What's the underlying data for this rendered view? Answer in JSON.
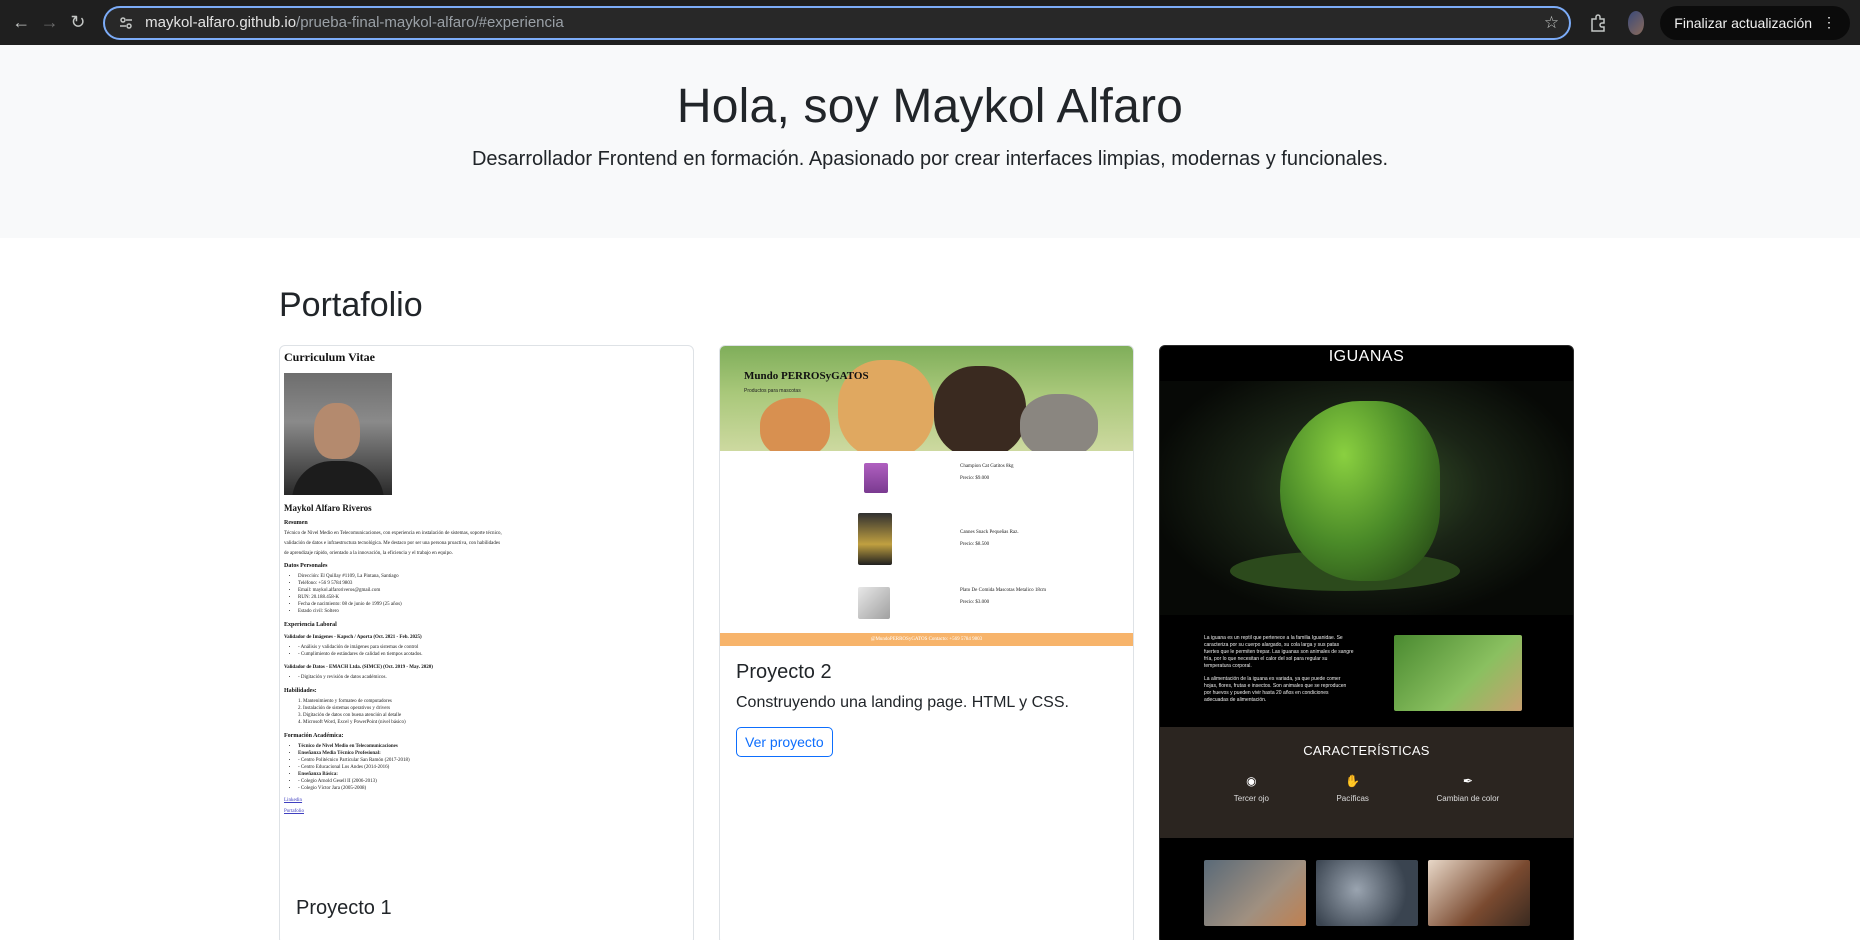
{
  "browser": {
    "url_host": "maykol-alfaro.github.io",
    "url_path": "/prueba-final-maykol-alfaro/#experiencia",
    "update_button": "Finalizar actualización"
  },
  "hero": {
    "title": "Hola, soy Maykol Alfaro",
    "subtitle": "Desarrollador Frontend en formación. Apasionado por crear interfaces limpias, modernas y funcionales."
  },
  "portfolio": {
    "heading": "Portafolio",
    "cards": [
      {
        "title": "Proyecto 1",
        "preview": {
          "heading": "Curriculum Vitae",
          "name": "Maykol Alfaro Riveros",
          "resumen_h": "Resumen",
          "resumen": [
            "Técnico de Nivel Medio en Telecomunicaciones, con experiencia en instalación de sistemas, soporte técnico,",
            "validación de datos e infraestructura tecnológica. Me destaco por ser una persona proactiva, con habilidades",
            "de aprendizaje rápido, orientado a la innovación, la eficiencia y el trabajo en equipo."
          ],
          "datos_h": "Datos Personales",
          "datos": [
            "Dirección: El Quillay #1109, La Pintana, Santiago",
            "Teléfono: +56 9 5784 9803",
            "Email: maykol.alfaroriveros@gmail.com",
            "RUN: 20.188.458-K",
            "Fecha de nacimiento: 08 de junio de 1999 (25 años)",
            "Estado civil: Soltero"
          ],
          "exp_h": "Experiencia Laboral",
          "exp1_h": "Validador de Imágenes - Kapsch / Aporta (Oct. 2021 - Feb. 2025)",
          "exp1": [
            "- Análisis y validación de imágenes para sistemas de control",
            "- Cumplimiento de estándares de calidad en tiempos acotados."
          ],
          "exp2_h": "Validador de Datos - EMACH Ltda. (SIMCE) (Oct. 2019 - May. 2020)",
          "exp2": [
            "- Digitación y revisión de datos académicos."
          ],
          "hab_h": "Habilidades:",
          "hab": [
            "1. Mantenimiento y formateo de computadores",
            "2. Instalación de sistemas operativos y drivers",
            "3. Digitación de datos con buena atención al detalle",
            "4. Microsoft Word, Excel y PowerPoint (nivel básico)"
          ],
          "form_h": "Formación Académica:",
          "form": [
            "Técnico de Nivel Medio en Telecomunicaciones",
            "Enseñanza Media Técnico Profesional:",
            "- Centro Politécnico Particular San Ramón (2017-2018)",
            "- Centro Educacional Los Andes (2014-2016)",
            "Enseñanza Básica:",
            "- Colegio Arnold Gesell II (2006-2013)",
            "- Colegio Víctor Jara (2005-2008)"
          ],
          "link1": "Linkedin",
          "link2": "Portafolio"
        }
      },
      {
        "title": "Proyecto 2",
        "description": "Construyendo una landing page. HTML y CSS.",
        "button": "Ver proyecto",
        "preview": {
          "brand": "Mundo PERROSyGATOS",
          "tagline": "Productos para mascotas",
          "products": [
            {
              "name": "Champion Cat Gatitos 8kg",
              "price": "Precio: $9.000"
            },
            {
              "name": "Cannes Snack Pequeñas Raz.",
              "price": "Precio: $8.500"
            },
            {
              "name": "Plato De Comida Mascotas Metalico 18cm",
              "price": "Precio: $3.000"
            }
          ],
          "footer": "@MundoPERROSyGATOS Contacto: +569 5784 9803"
        }
      },
      {
        "preview": {
          "title": "IGUANAS",
          "text1": "La iguana es un reptil que pertenece a la familia Iguanidae. Se caracteriza por su cuerpo alargado, su cola larga y sus patas fuertes que le permiten trepar. Las iguanas son animales de sangre fría, por lo que necesitan el calor del sol para regular su temperatura corporal.",
          "text2": "La alimentación de la iguana es variada, ya que puede comer hojas, flores, frutas e insectos. Son animales que se reproducen por huevos y pueden vivir hasta 20 años en condiciones adecuadas de alimentación.",
          "features_h": "CARACTERÍSTICAS",
          "features": [
            {
              "icon": "eye-icon",
              "label": "Tercer ojo"
            },
            {
              "icon": "hand-icon",
              "label": "Pacíficas"
            },
            {
              "icon": "brush-icon",
              "label": "Cambian de color"
            }
          ]
        }
      }
    ]
  }
}
